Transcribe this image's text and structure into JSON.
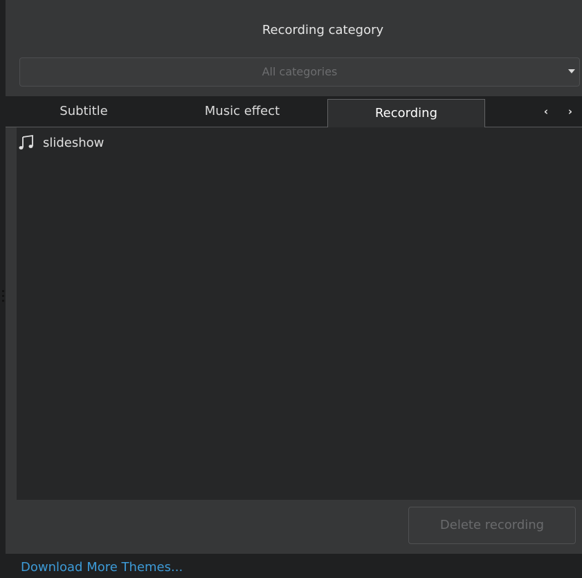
{
  "header": {
    "title": "Recording category"
  },
  "category_select": {
    "value": "All categories"
  },
  "tabs": [
    {
      "label": "Subtitle"
    },
    {
      "label": "Music effect"
    },
    {
      "label": "Recording"
    }
  ],
  "tab_nav": {
    "prev": "‹",
    "next": "›"
  },
  "active_tab": "Recording",
  "list": {
    "items": [
      {
        "label": "slideshow",
        "icon": "music-note-icon"
      }
    ]
  },
  "actions": {
    "delete_label": "Delete recording",
    "delete_enabled": false
  },
  "footer": {
    "download_link": "Download More Themes..."
  },
  "colors": {
    "link": "#3d9bd8",
    "panel": "#363738",
    "list_bg": "#262728"
  }
}
